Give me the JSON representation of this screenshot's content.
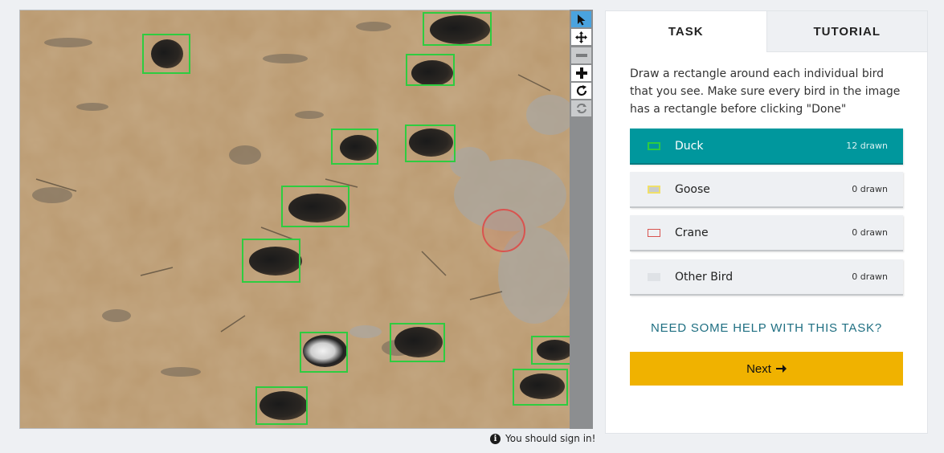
{
  "toolbar": {
    "tools": [
      {
        "icon": "pointer-icon",
        "state": "active"
      },
      {
        "icon": "move-icon",
        "state": "normal"
      },
      {
        "icon": "zoom-out-icon",
        "state": "disabled"
      },
      {
        "icon": "zoom-in-icon",
        "state": "normal"
      },
      {
        "icon": "rotate-icon",
        "state": "normal"
      },
      {
        "icon": "reset-icon",
        "state": "disabled"
      }
    ]
  },
  "signin_note": {
    "icon": "info-icon",
    "text": "You should sign in!"
  },
  "tabs": {
    "task": "TASK",
    "tutorial": "TUTORIAL",
    "active": "task"
  },
  "task": {
    "instructions": "Draw a rectangle around each individual bird that you see. Make sure every bird in the image has a rectangle before clicking \"Done\"",
    "choices": [
      {
        "label": "Duck",
        "count": "12 drawn",
        "color": "#2ecc40",
        "selected": true
      },
      {
        "label": "Goose",
        "count": "0 drawn",
        "color": "#f0e06a",
        "selected": false
      },
      {
        "label": "Crane",
        "count": "0 drawn",
        "color": "#d9534f",
        "selected": false
      },
      {
        "label": "Other Bird",
        "count": "0 drawn",
        "color": "#dfe2e6",
        "selected": false
      }
    ],
    "help_link": "NEED SOME HELP WITH THIS TASK?",
    "next_label": "Next",
    "next_icon": "arrow-right-icon"
  },
  "colors": {
    "accent_teal": "#00979d",
    "next_button": "#f0b200",
    "help_link": "#1f6f82",
    "duck_box": "#2ecc40",
    "marker": "#d9534f"
  }
}
